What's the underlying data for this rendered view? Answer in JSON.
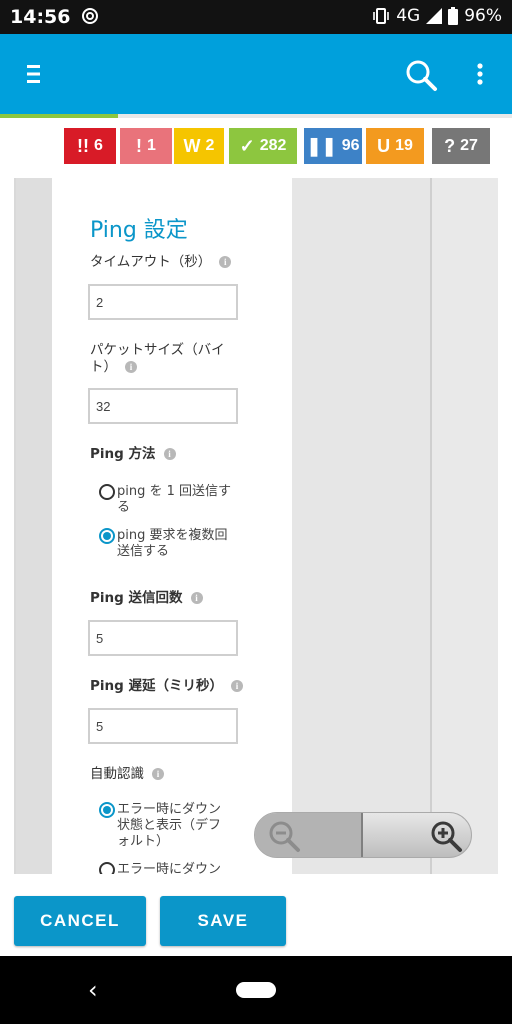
{
  "status": {
    "time": "14:56",
    "network": "4G",
    "battery": "96%"
  },
  "progress": {
    "fraction": 0.23
  },
  "badges": [
    {
      "glyph": "!!",
      "count": "6",
      "color": "#d81b27"
    },
    {
      "glyph": "!",
      "count": "1",
      "color": "#e9737b"
    },
    {
      "glyph": "W",
      "count": "2",
      "color": "#f5c500"
    },
    {
      "glyph": "✓",
      "count": "282",
      "color": "#8dc63f"
    },
    {
      "glyph": "❚❚",
      "count": "96",
      "color": "#3d82c7"
    },
    {
      "glyph": "U",
      "count": "19",
      "color": "#f39a1f"
    },
    {
      "glyph": "?",
      "count": "27",
      "color": "#777777"
    }
  ],
  "settings": {
    "title": "Ping 設定",
    "timeout": {
      "label": "タイムアウト（秒）",
      "value": "2"
    },
    "packet_size": {
      "label_line1": "パケットサイズ（バイ",
      "label_line2": "ト）",
      "value": "32"
    },
    "ping_method": {
      "label": "Ping 方法",
      "options": [
        {
          "line1": "ping を 1 回送信す",
          "line2": "る",
          "selected": false
        },
        {
          "line1": "ping 要求を複数回",
          "line2": "送信する",
          "selected": true
        }
      ]
    },
    "send_count": {
      "label": "Ping 送信回数",
      "value": "5"
    },
    "delay": {
      "label": "Ping 遅延（ミリ秒）",
      "value": "5"
    },
    "auto_detect": {
      "label": "自動認識",
      "options": [
        {
          "line1": "エラー時にダウン",
          "line2": "状態と表示（デフ",
          "line3": "ォルト）",
          "selected": true
        },
        {
          "line1": "エラー時にダウン",
          "selected": false
        }
      ]
    }
  },
  "actions": {
    "cancel": "CANCEL",
    "save": "SAVE"
  }
}
